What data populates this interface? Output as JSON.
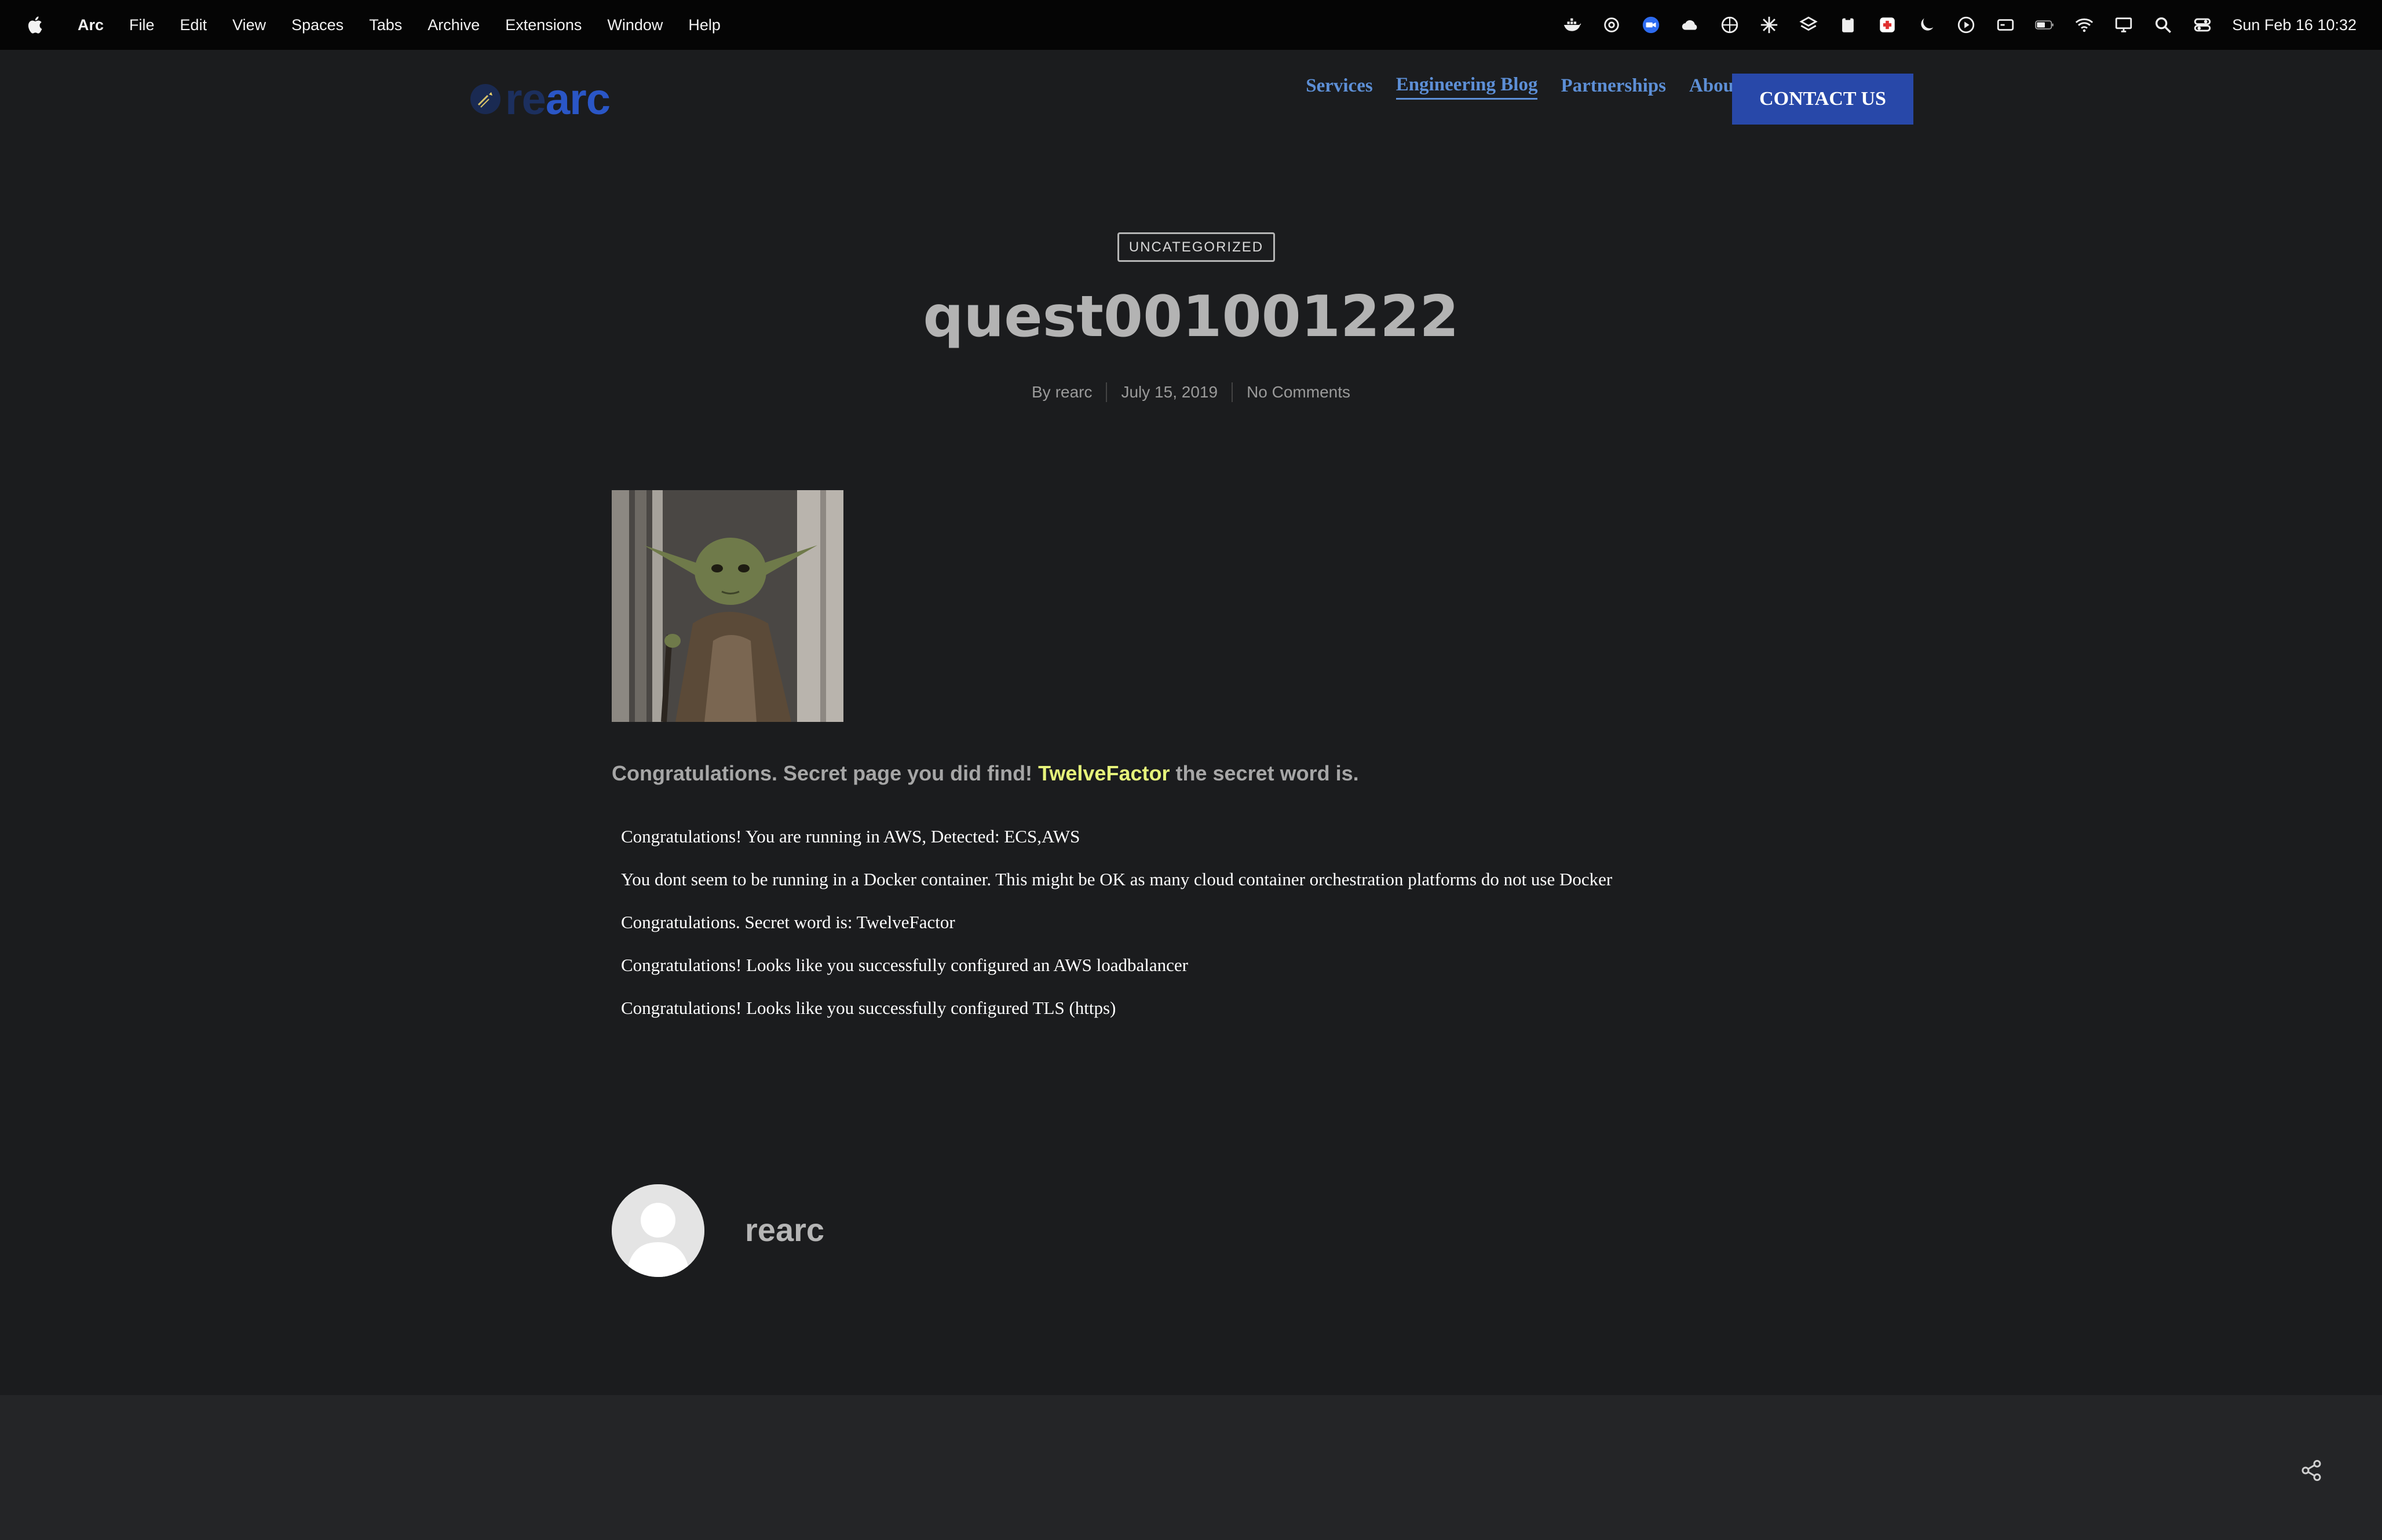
{
  "menubar": {
    "app_name": "Arc",
    "items": [
      "File",
      "Edit",
      "View",
      "Spaces",
      "Tabs",
      "Archive",
      "Extensions",
      "Window",
      "Help"
    ],
    "clock": "Sun Feb 16  10:32",
    "tray_icons": [
      "docker-icon",
      "chatgpt-icon",
      "zoom-icon",
      "cloud-icon",
      "grid-icon",
      "spark-icon",
      "layers-icon",
      "clipboard-icon",
      "health-icon",
      "moon-icon",
      "play-icon",
      "card-icon",
      "battery-icon",
      "wifi-icon",
      "display-icon",
      "search-icon",
      "control-center-icon"
    ]
  },
  "site": {
    "logo_re": "re",
    "logo_arc": "arc",
    "nav": {
      "services": "Services",
      "engineering_blog": "Engineering Blog",
      "partnerships": "Partnerships",
      "about": "About",
      "contact": "CONTACT US"
    },
    "colors": {
      "brand": "#2a56c6",
      "nav_link": "#5d8fd6",
      "cta": "#2848a9",
      "highlight": "#e5f27a"
    }
  },
  "post": {
    "category": "UNCATEGORIZED",
    "title": "quest001001222",
    "author_prefix": "By",
    "author": "rearc",
    "date": "July 15, 2019",
    "comments": "No Comments",
    "congrats_before": "Congratulations. Secret page you did find!",
    "secret_word": "TwelveFactor",
    "congrats_after": "the secret word is.",
    "results": [
      "Congratulations! You are running in AWS, Detected: ECS,AWS",
      "You dont seem to be running in a Docker container. This might be OK as many cloud container orchestration platforms do not use Docker",
      "Congratulations. Secret word is: TwelveFactor",
      "Congratulations! Looks like you successfully configured an AWS loadbalancer",
      "Congratulations! Looks like you successfully configured TLS (https)"
    ]
  },
  "author_box": {
    "name": "rearc"
  }
}
